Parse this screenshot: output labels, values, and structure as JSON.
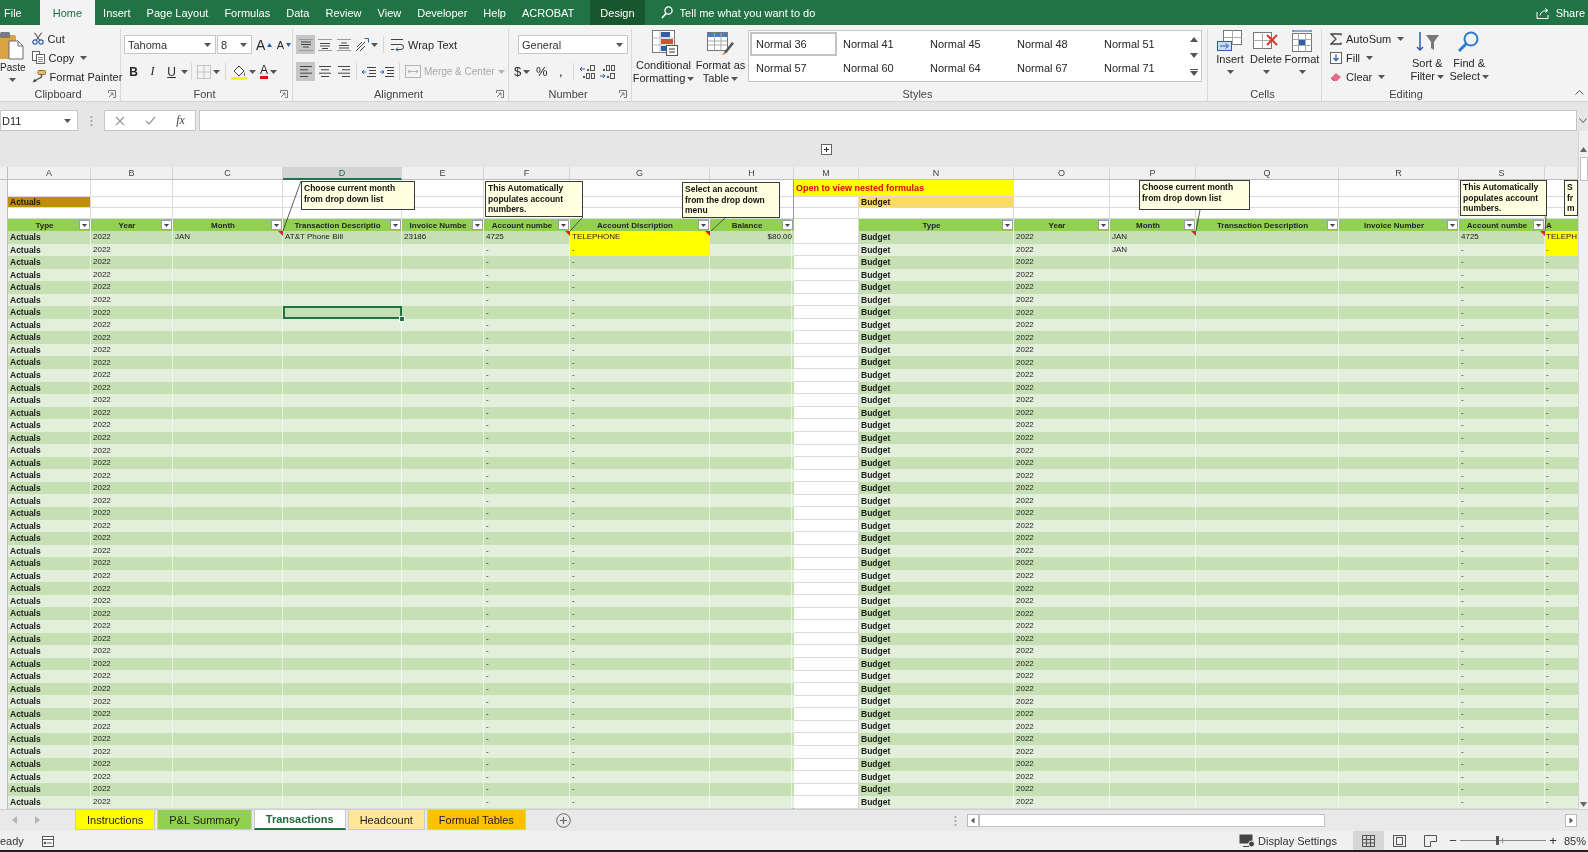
{
  "ribbon_tabs": [
    {
      "label": "File",
      "kind": "file",
      "selected": false
    },
    {
      "label": "Home",
      "kind": "normal",
      "selected": true
    },
    {
      "label": "Insert",
      "kind": "normal",
      "selected": false
    },
    {
      "label": "Page Layout",
      "kind": "normal",
      "selected": false
    },
    {
      "label": "Formulas",
      "kind": "normal",
      "selected": false
    },
    {
      "label": "Data",
      "kind": "normal",
      "selected": false
    },
    {
      "label": "Review",
      "kind": "normal",
      "selected": false
    },
    {
      "label": "View",
      "kind": "normal",
      "selected": false
    },
    {
      "label": "Developer",
      "kind": "normal",
      "selected": false
    },
    {
      "label": "Help",
      "kind": "normal",
      "selected": false
    },
    {
      "label": "ACROBAT",
      "kind": "normal",
      "selected": false
    },
    {
      "label": "Design",
      "kind": "contextual",
      "selected": false
    }
  ],
  "tell_me": {
    "placeholder": "Tell me what you want to do"
  },
  "share": "Share",
  "clipboard": {
    "paste": "Paste",
    "cut": "Cut",
    "copy": "Copy",
    "format_painter": "Format Painter",
    "label": "Clipboard"
  },
  "font": {
    "family": "Tahoma",
    "size": "8",
    "grow": "A",
    "shrink": "A",
    "bold": "B",
    "italic": "I",
    "underline": "U",
    "font_color": "A",
    "label": "Font"
  },
  "alignment": {
    "vertical": [
      {
        "kind": "top",
        "selected": true
      },
      {
        "kind": "middle",
        "selected": false
      },
      {
        "kind": "bottom",
        "selected": false
      }
    ],
    "wrap_text": "Wrap Text",
    "horizontal": [
      {
        "kind": "left",
        "selected": true
      },
      {
        "kind": "center",
        "selected": false
      },
      {
        "kind": "right",
        "selected": false
      }
    ],
    "merge_center": {
      "label": "Merge & Center",
      "disabled": true
    },
    "label": "Alignment"
  },
  "number": {
    "format": "General",
    "currency": "$",
    "percent": "%",
    "comma": ",",
    "label": "Number"
  },
  "styles": {
    "conditional_formatting": "Conditional Formatting",
    "format_as_table": "Format as Table",
    "gallery": [
      {
        "label": "Normal 36",
        "selected": true
      },
      {
        "label": "Normal 41",
        "selected": false
      },
      {
        "label": "Normal 45",
        "selected": false
      },
      {
        "label": "Normal 48",
        "selected": false
      },
      {
        "label": "Normal 51",
        "selected": false
      },
      {
        "label": "Normal 57",
        "selected": false
      },
      {
        "label": "Normal 60",
        "selected": false
      },
      {
        "label": "Normal 64",
        "selected": false
      },
      {
        "label": "Normal 67",
        "selected": false
      },
      {
        "label": "Normal 71",
        "selected": false
      }
    ],
    "label": "Styles"
  },
  "cells": {
    "buttons": [
      {
        "kind": "insert",
        "label": "Insert"
      },
      {
        "kind": "delete",
        "label": "Delete"
      },
      {
        "kind": "format",
        "label": "Format"
      }
    ],
    "label": "Cells"
  },
  "editing": {
    "autosum": "AutoSum",
    "fill": "Fill",
    "clear": "Clear",
    "sort_filter": "Sort & Filter",
    "find_select": "Find & Select",
    "label": "Editing"
  },
  "formula_bar": {
    "name_box": "D11",
    "function": "fx"
  },
  "sheet": {
    "column_headers": [
      {
        "label": "A",
        "selected": false
      },
      {
        "label": "B",
        "selected": false
      },
      {
        "label": "C",
        "selected": false
      },
      {
        "label": "D",
        "selected": true
      },
      {
        "label": "E",
        "selected": false
      },
      {
        "label": "F",
        "selected": false
      },
      {
        "label": "G",
        "selected": false
      },
      {
        "label": "H",
        "selected": false
      },
      {
        "label": "M",
        "selected": false
      },
      {
        "label": "N",
        "selected": false
      },
      {
        "label": "O",
        "selected": false
      },
      {
        "label": "P",
        "selected": false
      },
      {
        "label": "Q",
        "selected": false
      },
      {
        "label": "R",
        "selected": false
      },
      {
        "label": "S",
        "selected": false
      }
    ],
    "banner": "Open to view nested formulas",
    "comments": [
      {
        "text": "Choose current month from drop down list"
      },
      {
        "text": "This Automatically populates account numbers."
      },
      {
        "text": "Select an account from the drop down menu"
      },
      {
        "text": "Choose current month from drop down list"
      },
      {
        "text": "This Automatically populates account numbers."
      },
      {
        "text": "S fr m"
      }
    ],
    "tables": [
      {
        "label": "Actuals",
        "columns": [
          "Type",
          "Year",
          "Month",
          "Transaction Descriptio",
          "Invoice Numbe",
          "Account numbe",
          "Account Discription",
          "Balance"
        ],
        "rows": [
          {
            "type": "Actuals",
            "year": "2022",
            "month": "JAN",
            "transaction_description": "AT&T Phone Bill",
            "invoice_number": "23186",
            "account_number": "4725",
            "account_description": "TELEPHONE",
            "balance": "$80.00",
            "highlighted": true,
            "selected": false
          },
          {
            "type": "Actuals",
            "year": "2022",
            "account_number": "-",
            "account_description": "-",
            "highlighted": true,
            "selected": false
          },
          {
            "type": "Actuals",
            "year": "2022",
            "account_number": "-",
            "account_description": "-",
            "highlighted": false,
            "selected": false
          },
          {
            "type": "Actuals",
            "year": "2022",
            "account_number": "-",
            "account_description": "-",
            "highlighted": false,
            "selected": false
          },
          {
            "type": "Actuals",
            "year": "2022",
            "account_number": "-",
            "account_description": "-",
            "highlighted": false,
            "selected": false
          },
          {
            "type": "Actuals",
            "year": "2022",
            "account_number": "-",
            "account_description": "-",
            "highlighted": false,
            "selected": false
          },
          {
            "type": "Actuals",
            "year": "2022",
            "account_number": "-",
            "account_description": "-",
            "highlighted": false,
            "selected": true
          },
          {
            "type": "Actuals",
            "year": "2022",
            "account_number": "-",
            "account_description": "-",
            "highlighted": false,
            "selected": false
          },
          {
            "type": "Actuals",
            "year": "2022",
            "account_number": "-",
            "account_description": "-",
            "highlighted": false,
            "selected": false
          },
          {
            "type": "Actuals",
            "year": "2022",
            "account_number": "-",
            "account_description": "-",
            "highlighted": false,
            "selected": false
          },
          {
            "type": "Actuals",
            "year": "2022",
            "account_number": "-",
            "account_description": "-",
            "highlighted": false,
            "selected": false
          },
          {
            "type": "Actuals",
            "year": "2022",
            "account_number": "-",
            "account_description": "-",
            "highlighted": false,
            "selected": false
          },
          {
            "type": "Actuals",
            "year": "2022",
            "account_number": "-",
            "account_description": "-",
            "highlighted": false,
            "selected": false
          },
          {
            "type": "Actuals",
            "year": "2022",
            "account_number": "-",
            "account_description": "-",
            "highlighted": false,
            "selected": false
          },
          {
            "type": "Actuals",
            "year": "2022",
            "account_number": "-",
            "account_description": "-",
            "highlighted": false,
            "selected": false
          },
          {
            "type": "Actuals",
            "year": "2022",
            "account_number": "-",
            "account_description": "-",
            "highlighted": false,
            "selected": false
          },
          {
            "type": "Actuals",
            "year": "2022",
            "account_number": "-",
            "account_description": "-",
            "highlighted": false,
            "selected": false
          },
          {
            "type": "Actuals",
            "year": "2022",
            "account_number": "-",
            "account_description": "-",
            "highlighted": false,
            "selected": false
          },
          {
            "type": "Actuals",
            "year": "2022",
            "account_number": "-",
            "account_description": "-",
            "highlighted": false,
            "selected": false
          },
          {
            "type": "Actuals",
            "year": "2022",
            "account_number": "-",
            "account_description": "-",
            "highlighted": false,
            "selected": false
          },
          {
            "type": "Actuals",
            "year": "2022",
            "account_number": "-",
            "account_description": "-",
            "highlighted": false,
            "selected": false
          },
          {
            "type": "Actuals",
            "year": "2022",
            "account_number": "-",
            "account_description": "-",
            "highlighted": false,
            "selected": false
          },
          {
            "type": "Actuals",
            "year": "2022",
            "account_number": "-",
            "account_description": "-",
            "highlighted": false,
            "selected": false
          },
          {
            "type": "Actuals",
            "year": "2022",
            "account_number": "-",
            "account_description": "-",
            "highlighted": false,
            "selected": false
          },
          {
            "type": "Actuals",
            "year": "2022",
            "account_number": "-",
            "account_description": "-",
            "highlighted": false,
            "selected": false
          },
          {
            "type": "Actuals",
            "year": "2022",
            "account_number": "-",
            "account_description": "-",
            "highlighted": false,
            "selected": false
          },
          {
            "type": "Actuals",
            "year": "2022",
            "account_number": "-",
            "account_description": "-",
            "highlighted": false,
            "selected": false
          },
          {
            "type": "Actuals",
            "year": "2022",
            "account_number": "-",
            "account_description": "-",
            "highlighted": false,
            "selected": false
          },
          {
            "type": "Actuals",
            "year": "2022",
            "account_number": "-",
            "account_description": "-",
            "highlighted": false,
            "selected": false
          },
          {
            "type": "Actuals",
            "year": "2022",
            "account_number": "-",
            "account_description": "-",
            "highlighted": false,
            "selected": false
          },
          {
            "type": "Actuals",
            "year": "2022",
            "account_number": "-",
            "account_description": "-",
            "highlighted": false,
            "selected": false
          },
          {
            "type": "Actuals",
            "year": "2022",
            "account_number": "-",
            "account_description": "-",
            "highlighted": false,
            "selected": false
          },
          {
            "type": "Actuals",
            "year": "2022",
            "account_number": "-",
            "account_description": "-",
            "highlighted": false,
            "selected": false
          },
          {
            "type": "Actuals",
            "year": "2022",
            "account_number": "-",
            "account_description": "-",
            "highlighted": false,
            "selected": false
          },
          {
            "type": "Actuals",
            "year": "2022",
            "account_number": "-",
            "account_description": "-",
            "highlighted": false,
            "selected": false
          },
          {
            "type": "Actuals",
            "year": "2022",
            "account_number": "-",
            "account_description": "-",
            "highlighted": false,
            "selected": false
          },
          {
            "type": "Actuals",
            "year": "2022",
            "account_number": "-",
            "account_description": "-",
            "highlighted": false,
            "selected": false
          },
          {
            "type": "Actuals",
            "year": "2022",
            "account_number": "-",
            "account_description": "-",
            "highlighted": false,
            "selected": false
          },
          {
            "type": "Actuals",
            "year": "2022",
            "account_number": "-",
            "account_description": "-",
            "highlighted": false,
            "selected": false
          },
          {
            "type": "Actuals",
            "year": "2022",
            "account_number": "-",
            "account_description": "-",
            "highlighted": false,
            "selected": false
          },
          {
            "type": "Actuals",
            "year": "2022",
            "account_number": "-",
            "account_description": "-",
            "highlighted": false,
            "selected": false
          },
          {
            "type": "Actuals",
            "year": "2022",
            "account_number": "-",
            "account_description": "-",
            "highlighted": false,
            "selected": false
          },
          {
            "type": "Actuals",
            "year": "2022",
            "account_number": "-",
            "account_description": "-",
            "highlighted": false,
            "selected": false
          },
          {
            "type": "Actuals",
            "year": "2022",
            "account_number": "-",
            "account_description": "-",
            "highlighted": false,
            "selected": false
          },
          {
            "type": "Actuals",
            "year": "2022",
            "account_number": "-",
            "account_description": "-",
            "highlighted": false,
            "selected": false
          },
          {
            "type": "Actuals",
            "year": "2022",
            "account_number": "-",
            "account_description": "-",
            "highlighted": false,
            "selected": false
          }
        ]
      },
      {
        "label": "Budget",
        "columns": [
          "Type",
          "Year",
          "Month",
          "Transaction Description",
          "Invoice Number",
          "Account numbe",
          "A"
        ],
        "rows": [
          {
            "type": "Budget",
            "year": "2022",
            "month": "JAN",
            "account_number": "4725",
            "column_7": "TELEPH",
            "highlighted": true
          },
          {
            "type": "Budget",
            "year": "2022",
            "month": "JAN",
            "account_number": "-",
            "column_7": "-",
            "highlighted": true
          },
          {
            "type": "Budget",
            "year": "2022",
            "account_number": "-",
            "column_7": "-",
            "highlighted": false
          },
          {
            "type": "Budget",
            "year": "2022",
            "account_number": "-",
            "column_7": "-",
            "highlighted": false
          },
          {
            "type": "Budget",
            "year": "2022",
            "account_number": "-",
            "column_7": "-",
            "highlighted": false
          },
          {
            "type": "Budget",
            "year": "2022",
            "account_number": "-",
            "column_7": "-",
            "highlighted": false
          },
          {
            "type": "Budget",
            "year": "2022",
            "account_number": "-",
            "column_7": "-",
            "highlighted": false
          },
          {
            "type": "Budget",
            "year": "2022",
            "account_number": "-",
            "column_7": "-",
            "highlighted": false
          },
          {
            "type": "Budget",
            "year": "2022",
            "account_number": "-",
            "column_7": "-",
            "highlighted": false
          },
          {
            "type": "Budget",
            "year": "2022",
            "account_number": "-",
            "column_7": "-",
            "highlighted": false
          },
          {
            "type": "Budget",
            "year": "2022",
            "account_number": "-",
            "column_7": "-",
            "highlighted": false
          },
          {
            "type": "Budget",
            "year": "2022",
            "account_number": "-",
            "column_7": "-",
            "highlighted": false
          },
          {
            "type": "Budget",
            "year": "2022",
            "account_number": "-",
            "column_7": "-",
            "highlighted": false
          },
          {
            "type": "Budget",
            "year": "2022",
            "account_number": "-",
            "column_7": "-",
            "highlighted": false
          },
          {
            "type": "Budget",
            "year": "2022",
            "account_number": "-",
            "column_7": "-",
            "highlighted": false
          },
          {
            "type": "Budget",
            "year": "2022",
            "account_number": "-",
            "column_7": "-",
            "highlighted": false
          },
          {
            "type": "Budget",
            "year": "2022",
            "account_number": "-",
            "column_7": "-",
            "highlighted": false
          },
          {
            "type": "Budget",
            "year": "2022",
            "account_number": "-",
            "column_7": "-",
            "highlighted": false
          },
          {
            "type": "Budget",
            "year": "2022",
            "account_number": "-",
            "column_7": "-",
            "highlighted": false
          },
          {
            "type": "Budget",
            "year": "2022",
            "account_number": "-",
            "column_7": "-",
            "highlighted": false
          },
          {
            "type": "Budget",
            "year": "2022",
            "account_number": "-",
            "column_7": "-",
            "highlighted": false
          },
          {
            "type": "Budget",
            "year": "2022",
            "account_number": "-",
            "column_7": "-",
            "highlighted": false
          },
          {
            "type": "Budget",
            "year": "2022",
            "account_number": "-",
            "column_7": "-",
            "highlighted": false
          },
          {
            "type": "Budget",
            "year": "2022",
            "account_number": "-",
            "column_7": "-",
            "highlighted": false
          },
          {
            "type": "Budget",
            "year": "2022",
            "account_number": "-",
            "column_7": "-",
            "highlighted": false
          },
          {
            "type": "Budget",
            "year": "2022",
            "account_number": "-",
            "column_7": "-",
            "highlighted": false
          },
          {
            "type": "Budget",
            "year": "2022",
            "account_number": "-",
            "column_7": "-",
            "highlighted": false
          },
          {
            "type": "Budget",
            "year": "2022",
            "account_number": "-",
            "column_7": "-",
            "highlighted": false
          },
          {
            "type": "Budget",
            "year": "2022",
            "account_number": "-",
            "column_7": "-",
            "highlighted": false
          },
          {
            "type": "Budget",
            "year": "2022",
            "account_number": "-",
            "column_7": "-",
            "highlighted": false
          },
          {
            "type": "Budget",
            "year": "2022",
            "account_number": "-",
            "column_7": "-",
            "highlighted": false
          },
          {
            "type": "Budget",
            "year": "2022",
            "account_number": "-",
            "column_7": "-",
            "highlighted": false
          },
          {
            "type": "Budget",
            "year": "2022",
            "account_number": "-",
            "column_7": "-",
            "highlighted": false
          },
          {
            "type": "Budget",
            "year": "2022",
            "account_number": "-",
            "column_7": "-",
            "highlighted": false
          },
          {
            "type": "Budget",
            "year": "2022",
            "account_number": "-",
            "column_7": "-",
            "highlighted": false
          },
          {
            "type": "Budget",
            "year": "2022",
            "account_number": "-",
            "column_7": "-",
            "highlighted": false
          },
          {
            "type": "Budget",
            "year": "2022",
            "account_number": "-",
            "column_7": "-",
            "highlighted": false
          },
          {
            "type": "Budget",
            "year": "2022",
            "account_number": "-",
            "column_7": "-",
            "highlighted": false
          },
          {
            "type": "Budget",
            "year": "2022",
            "account_number": "-",
            "column_7": "-",
            "highlighted": false
          },
          {
            "type": "Budget",
            "year": "2022",
            "account_number": "-",
            "column_7": "-",
            "highlighted": false
          },
          {
            "type": "Budget",
            "year": "2022",
            "account_number": "-",
            "column_7": "-",
            "highlighted": false
          },
          {
            "type": "Budget",
            "year": "2022",
            "account_number": "-",
            "column_7": "-",
            "highlighted": false
          },
          {
            "type": "Budget",
            "year": "2022",
            "account_number": "-",
            "column_7": "-",
            "highlighted": false
          },
          {
            "type": "Budget",
            "year": "2022",
            "account_number": "-",
            "column_7": "-",
            "highlighted": false
          },
          {
            "type": "Budget",
            "year": "2022",
            "account_number": "-",
            "column_7": "-",
            "highlighted": false
          },
          {
            "type": "Budget",
            "year": "2022",
            "account_number": "-",
            "column_7": "-",
            "highlighted": false
          }
        ]
      }
    ]
  },
  "sheet_tabs": [
    {
      "label": "Instructions",
      "color": "#ffff00",
      "selected": false
    },
    {
      "label": "P&L Summary",
      "color": "#92d050",
      "selected": false
    },
    {
      "label": "Transactions",
      "selected": true
    },
    {
      "label": "Headcount",
      "color": "#ffe699",
      "selected": false
    },
    {
      "label": "Formual Tables",
      "color": "#ffc000",
      "selected": false
    }
  ],
  "status_bar": {
    "mode": "eady",
    "display_settings": "Display Settings",
    "views": [
      {
        "kind": "normal",
        "selected": true
      },
      {
        "kind": "page_layout",
        "selected": false
      },
      {
        "kind": "page_break",
        "selected": false
      }
    ],
    "zoom_out": "−",
    "zoom": {
      "level": 0.43
    },
    "zoom_in": "+",
    "zoom_label": "85%"
  }
}
